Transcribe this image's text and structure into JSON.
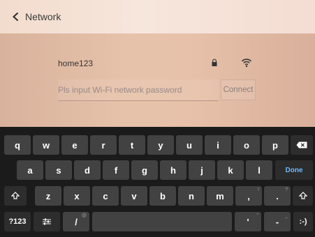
{
  "header": {
    "back_label": "Network"
  },
  "network": {
    "ssid": "home123",
    "password_placeholder": "Pls input Wi-Fi network password",
    "connect_label": "Connect"
  },
  "keyboard": {
    "row1": [
      "q",
      "w",
      "e",
      "r",
      "t",
      "y",
      "u",
      "i",
      "o",
      "p"
    ],
    "row2": [
      "a",
      "s",
      "d",
      "f",
      "g",
      "h",
      "j",
      "k",
      "l"
    ],
    "row3": [
      "z",
      "x",
      "c",
      "v",
      "b",
      "n",
      "m",
      ",",
      "."
    ],
    "row3_hints": [
      "!",
      "?"
    ],
    "done_label": "Done",
    "symbols_label": "?123",
    "slash_label": "/",
    "slash_hint": "@",
    "apostrophe_label": "'",
    "apostrophe_hint": "\"",
    "dash_label": "-",
    "dash_hint": "_",
    "emoticon_label": ":-)"
  }
}
